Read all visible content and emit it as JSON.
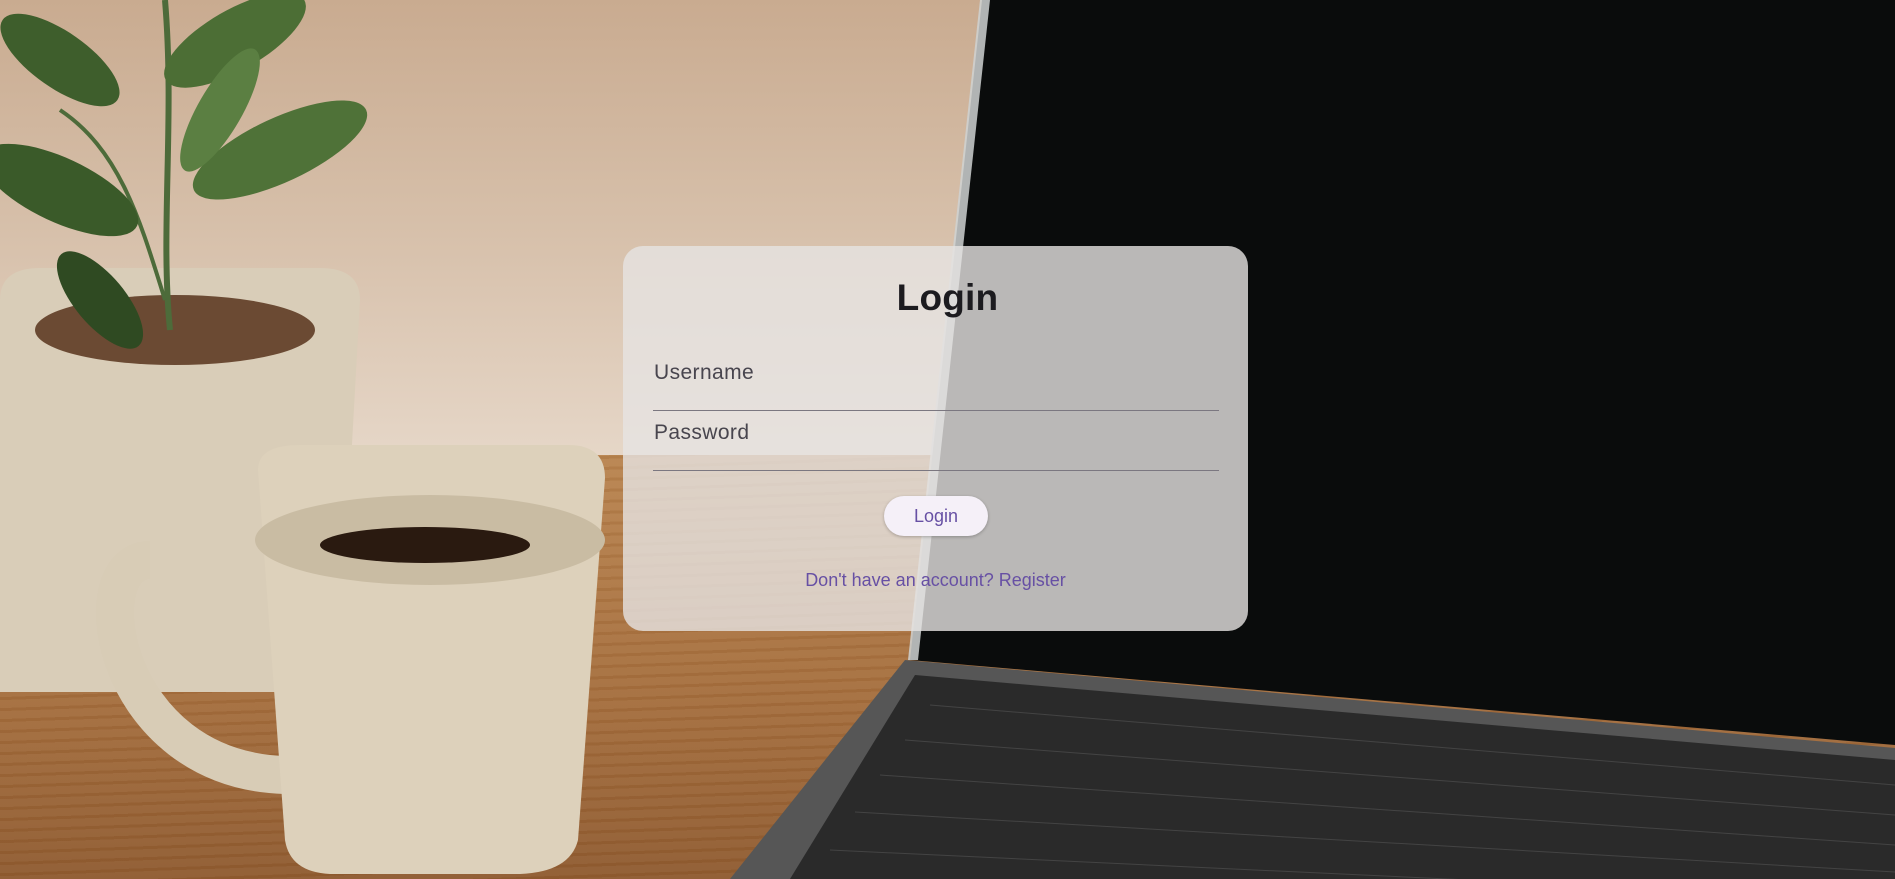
{
  "login_form": {
    "title": "Login",
    "username_label": "Username",
    "password_label": "Password",
    "login_button_label": "Login",
    "register_prompt": "Don't have an account? Register"
  },
  "colors": {
    "primary": "#6750a4",
    "text": "#1c1b1f",
    "card_background": "rgba(230,228,226,0.80)"
  }
}
